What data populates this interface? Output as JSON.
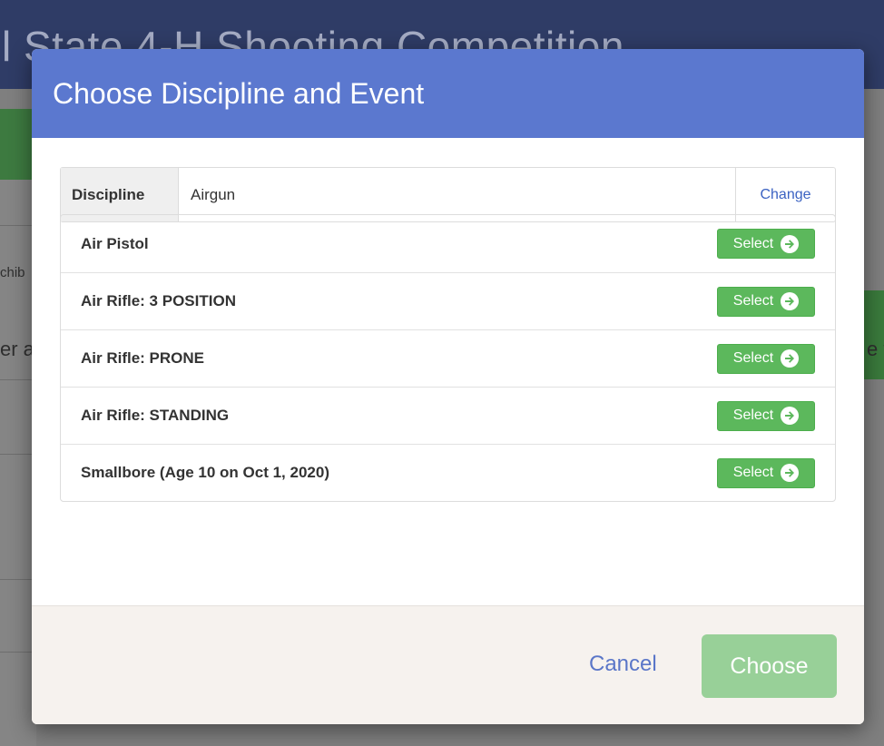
{
  "background": {
    "title": "l State 4-H Shooting Competition",
    "fragment_left_small": "chib",
    "fragment_left": "er a",
    "fragment_right": "e t"
  },
  "modal": {
    "title": "Choose Discipline and Event",
    "discipline": {
      "label": "Discipline",
      "value": "Airgun",
      "change_label": "Change"
    },
    "events": [
      {
        "name": "Air Pistol",
        "button": "Select"
      },
      {
        "name": "Air Rifle: 3 POSITION",
        "button": "Select"
      },
      {
        "name": "Air Rifle: PRONE",
        "button": "Select"
      },
      {
        "name": "Air Rifle: STANDING",
        "button": "Select"
      },
      {
        "name": "Smallbore (Age 10 on Oct 1, 2020)",
        "button": "Select"
      }
    ],
    "footer": {
      "cancel_label": "Cancel",
      "choose_label": "Choose"
    }
  },
  "icons": {
    "select_arrow": "arrow-circle-right-icon"
  },
  "colors": {
    "header_blue": "#5b78cf",
    "select_green": "#5cb85c",
    "choose_disabled_green": "#98d098",
    "link_blue": "#3b62c2"
  }
}
